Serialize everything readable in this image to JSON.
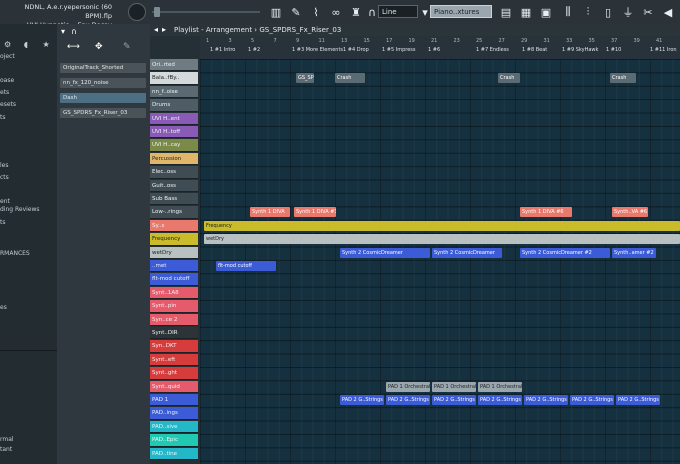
{
  "project": {
    "file_line": "NDNL, A.e.r.yepersonic (60 BPM).flp",
    "hint_line": "UVI Hypnotic..- Env Decay"
  },
  "toolbar": {
    "snap_value": "Line",
    "pattern_value": "Piano..xtures"
  },
  "browser": {
    "items": [
      "oject",
      "",
      "oase",
      "ets",
      "esets",
      "ts",
      "",
      "",
      "les",
      "cts",
      "ent",
      "ding Reviews",
      "ts",
      "",
      "RMANCES",
      "",
      "",
      "",
      "es",
      "",
      "",
      "",
      "",
      "",
      "rmal",
      "tant"
    ]
  },
  "playlist": {
    "title": "Playlist - Arrangement",
    "pattern": "GS_SPDRS_Fx_Riser_03"
  },
  "clip_list": [
    "OriginalTrack_Shorted",
    "nn_fx_120_noise",
    "Dash",
    "GS_SPDRS_Fx_Riser_03"
  ],
  "ruler": {
    "bars": [
      "1",
      "3",
      "5",
      "7",
      "9",
      "11",
      "13",
      "15",
      "17",
      "19",
      "21",
      "23",
      "25",
      "27",
      "29",
      "31",
      "33",
      "35",
      "37",
      "39",
      "41"
    ],
    "markers": [
      "1 #1 Intro",
      "1 #2",
      "1 #3 More Elements",
      "1 #4 Drop",
      "1 #5 Impress",
      "1 #6",
      "1 #7 Endless",
      "1 #8 Beat",
      "1 #9 SkyHawk",
      "1 #10",
      "1 #11 Iron"
    ]
  },
  "tracks": [
    {
      "name": "Ori..rted",
      "color": "#6f7b82"
    },
    {
      "name": "Bala..fBy..",
      "color": "#d4d9db"
    },
    {
      "name": "nn_f..oise",
      "color": "#5b6a72"
    },
    {
      "name": "Drums",
      "color": "#4e5d65"
    },
    {
      "name": "UVI H..ent",
      "color": "#8a5bb6"
    },
    {
      "name": "UVI H..toff",
      "color": "#8a5bb6"
    },
    {
      "name": "UVI H..cay",
      "color": "#7b8a48"
    },
    {
      "name": "Percussion",
      "color": "#e0b66a"
    },
    {
      "name": "Elec..oss",
      "color": "#3f4c53"
    },
    {
      "name": "Guit..oss",
      "color": "#3f4c53"
    },
    {
      "name": "Sub Bass",
      "color": "#3f4c53"
    },
    {
      "name": "Low-..rings",
      "color": "#3f4c53"
    },
    {
      "name": "Sy..s",
      "color": "#e8796c"
    },
    {
      "name": "Frequency",
      "color": "#c9bb2a"
    },
    {
      "name": "wetDry",
      "color": "#b9c0c2"
    },
    {
      "name": "..met",
      "color": "#3c5bd6"
    },
    {
      "name": "flt-mod cutoff",
      "color": "#3c5bd6"
    },
    {
      "name": "Synt..1A8",
      "color": "#e55b6c"
    },
    {
      "name": "Synt..pin",
      "color": "#e55b6c"
    },
    {
      "name": "Syn..ce 2",
      "color": "#e55b6c"
    },
    {
      "name": "Synt..DIR",
      "color": "#2c3438"
    },
    {
      "name": "Syn..DKT",
      "color": "#d63c3c"
    },
    {
      "name": "Synt..eft",
      "color": "#d63c3c"
    },
    {
      "name": "Synt..ght",
      "color": "#d63c3c"
    },
    {
      "name": "Synt..quid",
      "color": "#e55b6c"
    },
    {
      "name": "PAD 1",
      "color": "#3c5bd6"
    },
    {
      "name": "PAD..ings",
      "color": "#3c5bd6"
    },
    {
      "name": "PAD..sive",
      "color": "#22b7c9"
    },
    {
      "name": "PAD..Epic",
      "color": "#22c9b2"
    },
    {
      "name": "PAD..tine",
      "color": "#22b7c9"
    }
  ],
  "clips": [
    {
      "label": "GS_SPD..",
      "track": 2,
      "color": "#5a6b74"
    },
    {
      "label": "Crash",
      "track": 2,
      "color": "#5a6b74"
    },
    {
      "label": "Crash",
      "track": 2,
      "color": "#5a6b74"
    },
    {
      "label": "Crash",
      "track": 2,
      "color": "#5a6b74"
    },
    {
      "label": "Synth 1 DIVA",
      "track": 12,
      "color": "#e8796c"
    },
    {
      "label": "Synth 1 DIVA #3",
      "track": 12,
      "color": "#e8796c"
    },
    {
      "label": "Synth 1 DIVA #6",
      "track": 12,
      "color": "#e8796c"
    },
    {
      "label": "Synth..VA #6",
      "track": 12,
      "color": "#e8796c"
    },
    {
      "label": "Frequency",
      "track": 13,
      "color": "#c9bb2a"
    },
    {
      "label": "wetDry",
      "track": 14,
      "color": "#b9c0c2"
    },
    {
      "label": "Synth 2 CosmicDreamer",
      "track": 15,
      "color": "#3c5bd6"
    },
    {
      "label": "Synth 2 CosmicDreamer",
      "track": 15,
      "color": "#3c5bd6"
    },
    {
      "label": "Synth 2 CosmicDreamer #2",
      "track": 15,
      "color": "#3c5bd6"
    },
    {
      "label": "Synth..amer #2",
      "track": 15,
      "color": "#3c5bd6"
    },
    {
      "label": "flt-mod cutoff",
      "track": 16,
      "color": "#3c5bd6"
    },
    {
      "label": "PAD 1 Orchestral",
      "track": 25,
      "color": "#9aa6ad"
    },
    {
      "label": "PAD 1 Orchestral",
      "track": 25,
      "color": "#9aa6ad"
    },
    {
      "label": "PAD 1 Orchestral",
      "track": 25,
      "color": "#9aa6ad"
    },
    {
      "label": "PAD 2 G..Strings",
      "track": 26,
      "color": "#3c5bd6"
    }
  ]
}
